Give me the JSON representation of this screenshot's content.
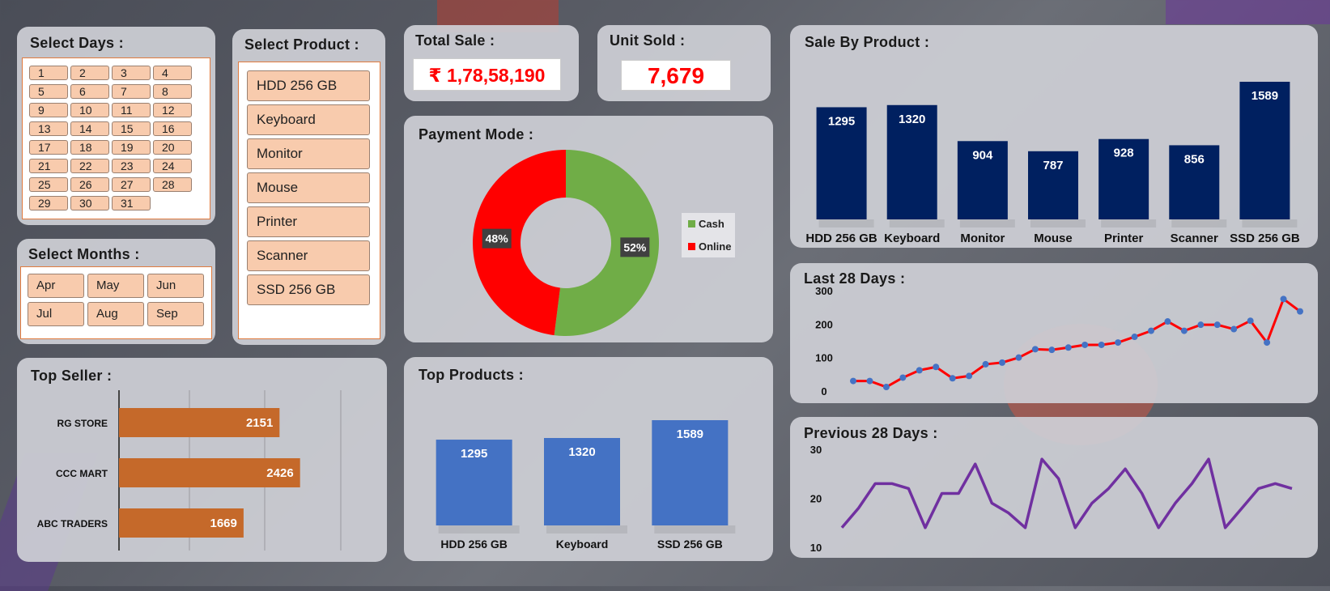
{
  "select_days": {
    "title": "Select Days :",
    "days": [
      "1",
      "2",
      "3",
      "4",
      "5",
      "6",
      "7",
      "8",
      "9",
      "10",
      "11",
      "12",
      "13",
      "14",
      "15",
      "16",
      "17",
      "18",
      "19",
      "20",
      "21",
      "22",
      "23",
      "24",
      "25",
      "26",
      "27",
      "28",
      "29",
      "30",
      "31"
    ]
  },
  "select_months": {
    "title": "Select Months :",
    "months": [
      "Apr",
      "May",
      "Jun",
      "Jul",
      "Aug",
      "Sep"
    ]
  },
  "select_product": {
    "title": "Select Product :",
    "products": [
      "HDD 256 GB",
      "Keyboard",
      "Monitor",
      "Mouse",
      "Printer",
      "Scanner",
      "SSD 256 GB"
    ]
  },
  "total_sale": {
    "title": "Total Sale :",
    "value": "₹ 1,78,58,190"
  },
  "unit_sold": {
    "title": "Unit Sold :",
    "value": "7,679"
  },
  "payment_mode": {
    "title": "Payment Mode :"
  },
  "sale_by_product": {
    "title": "Sale By Product :"
  },
  "last_28": {
    "title": "Last 28 Days :"
  },
  "prev_28": {
    "title": "Previous 28 Days :"
  },
  "top_seller": {
    "title": "Top Seller :"
  },
  "top_products": {
    "title": "Top Products :"
  },
  "colors": {
    "navy": "#002060",
    "cash": "#70ad47",
    "online": "#ff0000",
    "orange": "#c5692a",
    "blue_bar": "#4472c4",
    "line_red": "#ff0000",
    "line_marker": "#4472c4",
    "purple": "#7030a0"
  },
  "chart_data": [
    {
      "id": "payment_mode",
      "type": "pie",
      "categories": [
        "Cash",
        "Online"
      ],
      "values": [
        52,
        48
      ],
      "data_labels": [
        "52%",
        "48%"
      ],
      "legend": "right"
    },
    {
      "id": "sale_by_product",
      "type": "bar",
      "categories": [
        "HDD 256 GB",
        "Keyboard",
        "Monitor",
        "Mouse",
        "Printer",
        "Scanner",
        "SSD 256 GB"
      ],
      "values": [
        1295,
        1320,
        904,
        787,
        928,
        856,
        1589
      ]
    },
    {
      "id": "last_28_days",
      "type": "line",
      "x": [
        1,
        2,
        3,
        4,
        5,
        6,
        7,
        8,
        9,
        10,
        11,
        12,
        13,
        14,
        15,
        16,
        17,
        18,
        19,
        20,
        21,
        22,
        23,
        24,
        25,
        26,
        27,
        28
      ],
      "values": [
        30,
        30,
        12,
        40,
        62,
        72,
        38,
        45,
        80,
        85,
        100,
        125,
        123,
        130,
        138,
        138,
        145,
        162,
        180,
        208,
        180,
        198,
        198,
        185,
        210,
        145,
        275,
        238
      ],
      "y_ticks": [
        "0",
        "100",
        "200",
        "300"
      ],
      "ylim": [
        0,
        300
      ]
    },
    {
      "id": "previous_28_days",
      "type": "line",
      "x": [
        1,
        2,
        3,
        4,
        5,
        6,
        7,
        8,
        9,
        10,
        11,
        12,
        13,
        14,
        15,
        16,
        17,
        18,
        19,
        20,
        21,
        22,
        23,
        24,
        25,
        26,
        27,
        28
      ],
      "values": [
        14,
        18,
        23,
        23,
        22,
        14,
        21,
        21,
        27,
        19,
        17,
        14,
        28,
        24,
        14,
        19,
        22,
        26,
        21,
        14,
        19,
        23,
        28,
        14,
        18,
        22,
        23,
        22
      ],
      "y_ticks": [
        "10",
        "20",
        "30"
      ],
      "ylim": [
        10,
        30
      ]
    },
    {
      "id": "top_seller",
      "type": "bar",
      "orientation": "horizontal",
      "categories": [
        "RG STORE",
        "CCC MART",
        "ABC TRADERS"
      ],
      "values": [
        2151,
        2426,
        1669
      ]
    },
    {
      "id": "top_products",
      "type": "bar",
      "categories": [
        "HDD 256 GB",
        "Keyboard",
        "SSD 256 GB"
      ],
      "values": [
        1295,
        1320,
        1589
      ]
    }
  ]
}
